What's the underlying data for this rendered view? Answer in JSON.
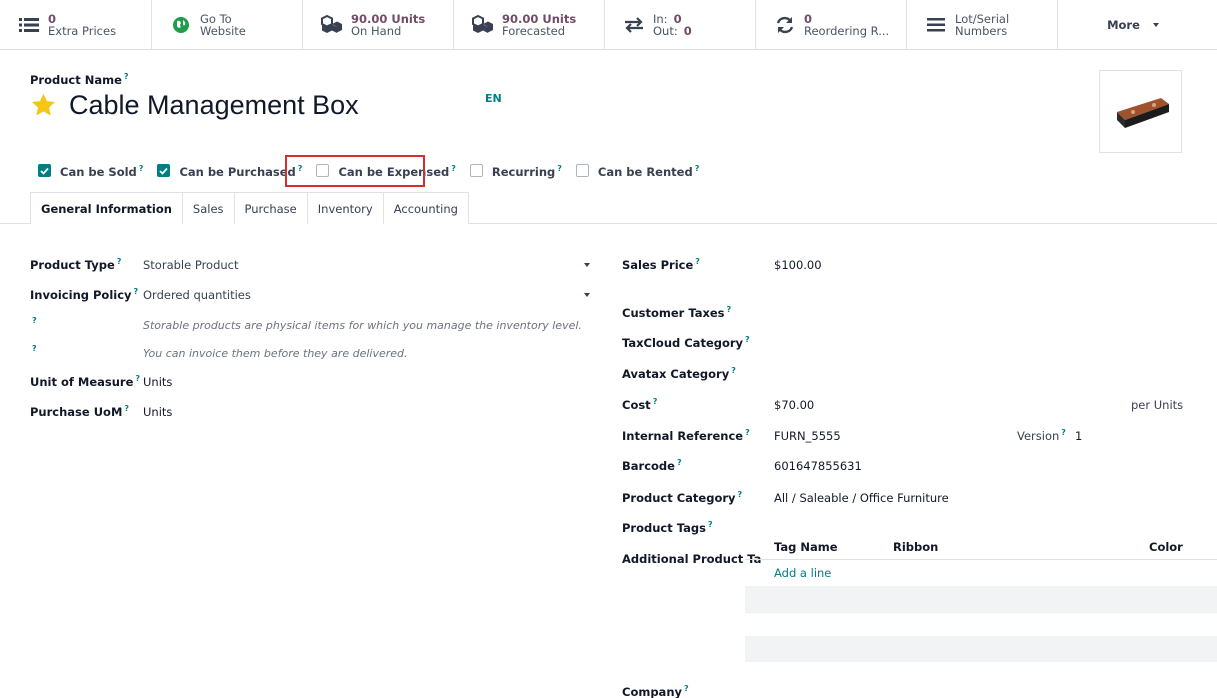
{
  "smart_buttons": [
    {
      "value": "0",
      "label": "Extra Prices",
      "icon": "list-icon"
    },
    {
      "value": "",
      "label_line1": "Go To",
      "label_line2": "Website",
      "icon": "globe-icon"
    },
    {
      "value": "90.00 Units",
      "label": "On Hand",
      "icon": "cubes-icon"
    },
    {
      "value": "90.00 Units",
      "label": "Forecasted",
      "icon": "cubes-icon"
    },
    {
      "in_label": "In:",
      "in_value": "0",
      "out_label": "Out:",
      "out_value": "0",
      "icon": "exchange-icon"
    },
    {
      "value": "0",
      "label": "Reordering R...",
      "icon": "refresh-icon"
    },
    {
      "label_line1": "Lot/Serial",
      "label_line2": "Numbers",
      "icon": "bars-icon"
    },
    {
      "label": "More"
    }
  ],
  "header": {
    "product_name_label": "Product Name",
    "product_name": "Cable Management Box",
    "lang": "EN",
    "tooltip_mark": "?"
  },
  "checkboxes": [
    {
      "label": "Can be Sold",
      "checked": true
    },
    {
      "label": "Can be Purchased",
      "checked": true
    },
    {
      "label": "Can be Expensed",
      "checked": false
    },
    {
      "label": "Recurring",
      "checked": false
    },
    {
      "label": "Can be Rented",
      "checked": false
    }
  ],
  "tabs": [
    "General Information",
    "Sales",
    "Purchase",
    "Inventory",
    "Accounting"
  ],
  "left_fields": {
    "product_type_label": "Product Type",
    "product_type": "Storable Product",
    "invoicing_policy_label": "Invoicing Policy",
    "invoicing_policy": "Ordered quantities",
    "hint1": "Storable products are physical items for which you manage the inventory level.",
    "hint2": "You can invoice them before they are delivered.",
    "uom_label": "Unit of Measure",
    "uom": "Units",
    "purchase_uom_label": "Purchase UoM",
    "purchase_uom": "Units"
  },
  "right_fields": {
    "sales_price_label": "Sales Price",
    "sales_price": "$100.00",
    "customer_taxes_label": "Customer Taxes",
    "taxcloud_label": "TaxCloud Category",
    "avatax_label": "Avatax Category",
    "cost_label": "Cost",
    "cost": "$70.00",
    "cost_unit": "per Units",
    "internal_ref_label": "Internal Reference",
    "internal_ref": "FURN_5555",
    "version_label": "Version",
    "version": "1",
    "barcode_label": "Barcode",
    "barcode": "601647855631",
    "category_label": "Product Category",
    "category": "All / Saleable / Office Furniture",
    "tags_label": "Product Tags",
    "additional_tags_label": "Additional Product Ta",
    "company_label": "Company"
  },
  "tag_table": {
    "headers": [
      "Tag Name",
      "Ribbon",
      "Color"
    ],
    "add_line": "Add a line"
  },
  "colors": {
    "accent": "#017e84",
    "brand": "#714b67",
    "highlight": "#d32f2f",
    "star": "#f5c518"
  }
}
